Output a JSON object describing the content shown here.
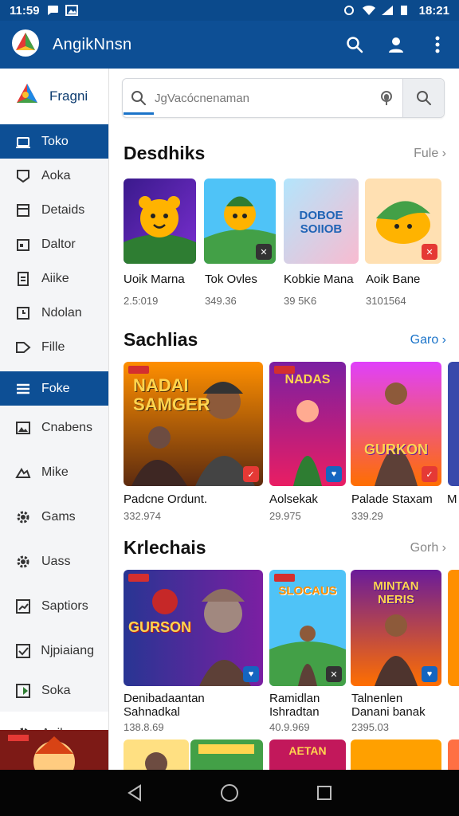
{
  "status_bar": {
    "time_left": "11:59",
    "time_right": "18:21"
  },
  "app_bar": {
    "title": "AngikNnsn"
  },
  "sidebar": {
    "account_name": "Fragni",
    "items": [
      {
        "label": "Toko",
        "icon": "store-icon",
        "active": true
      },
      {
        "label": "Aoka",
        "icon": "tag-icon"
      },
      {
        "label": "Detaids",
        "icon": "list-icon"
      },
      {
        "label": "Daltor",
        "icon": "calendar-icon"
      },
      {
        "label": "Aiike",
        "icon": "document-icon"
      },
      {
        "label": "Ndolan",
        "icon": "clock-icon"
      },
      {
        "label": "Fille",
        "icon": "label-icon"
      },
      {
        "label": "Foke",
        "icon": "menu-icon",
        "active": true
      },
      {
        "label": "Cnabens",
        "icon": "picture-icon"
      },
      {
        "label": "Mike",
        "icon": "cloud-icon"
      },
      {
        "label": "Gams",
        "icon": "gear-icon"
      },
      {
        "label": "Uass",
        "icon": "gear-icon"
      },
      {
        "label": "Saptiors",
        "icon": "chart-icon"
      },
      {
        "label": "Njpiaiang",
        "icon": "check-icon"
      },
      {
        "label": "Soka",
        "icon": "flag-icon"
      },
      {
        "label": "Apilanay",
        "icon": "gear-icon"
      }
    ]
  },
  "search": {
    "placeholder": "JgVacócnenaman"
  },
  "sections": [
    {
      "title": "Desdhiks",
      "more": "Fule",
      "cards": [
        {
          "title": "Uoik Marna",
          "sub": "2.5:019"
        },
        {
          "title": "Tok Ovles",
          "sub": "349.36"
        },
        {
          "title": "Kobkie Mana",
          "sub": "39 5K6"
        },
        {
          "title": "Aoik Bane",
          "sub": "3101564"
        }
      ]
    },
    {
      "title": "Sachlias",
      "more": "Garo",
      "cards": [
        {
          "title": "Padcne Ordunt.",
          "sub": "332.974"
        },
        {
          "title": "Aolsekak",
          "sub": "29.975"
        },
        {
          "title": "Palade Staxam",
          "sub": "339.29"
        },
        {
          "title": "M",
          "sub": ""
        }
      ]
    },
    {
      "title": "Krlechais",
      "more": "Gorh",
      "cards": [
        {
          "title": "Denibadaantan",
          "title2": "Sahnadkal",
          "sub": "138.8.69"
        },
        {
          "title": "Ramidlan",
          "title2": "Ishradtan",
          "sub": "40.9.969"
        },
        {
          "title": "Talnenlen",
          "title2": "Danani banak",
          "sub": "2395.03"
        },
        {
          "title": "",
          "title2": "",
          "sub": ""
        }
      ]
    }
  ],
  "tile_texts": {
    "t3": "DOBOE SOIIOB",
    "g1": "NADAI SAMGER",
    "g2": "NADAS",
    "g3": "GURKON",
    "k1": "GURSON",
    "k2": "SLOCAUS",
    "k3": "MINTAN NERIS",
    "b3": "AETAN"
  },
  "colors": {
    "brand": "#0d4f95",
    "accent": "#1a73c9"
  }
}
